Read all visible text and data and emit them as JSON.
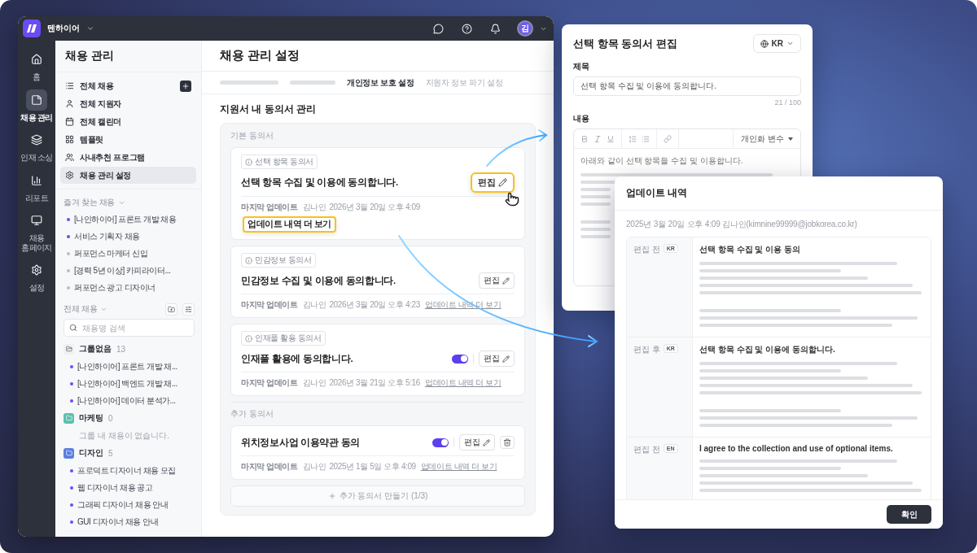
{
  "app": {
    "brand": "텐하이어",
    "avatar": "김",
    "rail": [
      {
        "label": "홈",
        "selected": false
      },
      {
        "label": "채용 관리",
        "selected": true
      },
      {
        "label": "인재 소싱",
        "selected": false
      },
      {
        "label": "리포트",
        "selected": false
      },
      {
        "label": "채용 홈페이지",
        "selected": false
      },
      {
        "label": "설정",
        "selected": false
      }
    ],
    "sidebar": {
      "title": "채용 관리",
      "nav": [
        {
          "label": "전체 채용",
          "kind": "with-add",
          "selected": false
        },
        {
          "label": "전체 지원자",
          "kind": "plain",
          "selected": false
        },
        {
          "label": "전체 캘린더",
          "kind": "plain",
          "selected": false
        },
        {
          "label": "템플릿",
          "kind": "plain",
          "selected": false
        },
        {
          "label": "사내추천 프로그램",
          "kind": "plain",
          "selected": false
        },
        {
          "label": "채용 관리 설정",
          "kind": "plain",
          "selected": true
        }
      ],
      "favorites": {
        "title": "즐겨 찾는 채용",
        "items": [
          {
            "label": "[나인하이어] 프론트 개발 채용",
            "color": "#6a4cf5"
          },
          {
            "label": "서비스 기획자 채용",
            "color": "#6a4cf5"
          },
          {
            "label": "퍼포먼스 마케터 신입",
            "color": "#b9bdc7"
          },
          {
            "label": "[경력 5년 이상] 카피라이터...",
            "color": "#b9bdc7"
          },
          {
            "label": "퍼포먼스 광고 디자이너",
            "color": "#b9bdc7"
          }
        ]
      },
      "all_jobs": {
        "title": "전체 채용",
        "search_placeholder": "채용명 검색",
        "groups": [
          {
            "name": "그룹없음",
            "count": "13",
            "items": [
              "[나인하이어] 프론트 개발 채...",
              "[나인하이어] 백엔드 개발 채...",
              "[나인하이어] 데이터 분석가..."
            ]
          },
          {
            "name": "마케팅",
            "count": "0",
            "color": "#5fbfae",
            "empty_text": "그룹 내 채용이 없습니다."
          },
          {
            "name": "디자인",
            "count": "5",
            "color": "#5b7fe0",
            "items": [
              "프로덕트 디자이너 채용 모집",
              "웹 디자이너 채용 공고",
              "그래픽 디자이너 채용 안내",
              "GUI 디자이너 채용 안내"
            ]
          }
        ]
      }
    }
  },
  "main": {
    "title": "채용 관리 설정",
    "tabs": [
      {
        "kind": "skeleton",
        "selected": false
      },
      {
        "kind": "skeleton",
        "selected": false
      },
      {
        "kind": "text",
        "label": "개인정보 보호 설정",
        "selected": true
      },
      {
        "kind": "text",
        "label": "지원자 정보 파기 설정",
        "selected": false
      }
    ],
    "section_title": "지원서 내 동의서 관리",
    "basic": {
      "title": "기본 동의서",
      "cards": [
        {
          "tag": "선택 항목 동의서",
          "title": "선택 항목 수집 및 이용에 동의합니다.",
          "edit_label": "편집",
          "update_label": "마지막 업데이트",
          "updated_by": "김나인",
          "updated_at": "2026년 3월 20일 오후 4:09",
          "history_link": "업데이트 내역 더 보기",
          "highlighted": true,
          "deletable": false
        },
        {
          "tag": "민감정보 동의서",
          "title": "민감정보 수집 및 이용에 동의합니다.",
          "edit_label": "편집",
          "update_label": "마지막 업데이트",
          "updated_by": "김나인",
          "updated_at": "2026년 3월 20일 오후 4:23",
          "history_link": "업데이트 내역 더 보기",
          "highlighted": false,
          "deletable": false
        },
        {
          "tag": "인재풀 활용 동의서",
          "title": "인재풀 활용에 동의합니다.",
          "toggle": {
            "on": true
          },
          "edit_label": "편집",
          "update_label": "마지막 업데이트",
          "updated_by": "김나인",
          "updated_at": "2026년 3월 21일 오후 5:16",
          "history_link": "업데이트 내역 더 보기",
          "highlighted": false,
          "deletable": false
        }
      ]
    },
    "extra": {
      "title": "추가 동의서",
      "cards": [
        {
          "title": "위치정보사업 이용약관 동의",
          "toggle": {
            "on": true
          },
          "edit_label": "편집",
          "update_label": "마지막 업데이트",
          "updated_by": "김나인",
          "updated_at": "2025년 1월 5일 오후 4:09",
          "history_link": "업데이트 내역 더 보기",
          "highlighted": false,
          "deletable": true
        }
      ],
      "create_button": "추가 동의서 만들기 (1/3)"
    }
  },
  "editor": {
    "title": "선택 항목 동의서 편집",
    "language": "KR",
    "subject_label": "제목",
    "subject_value": "선택 항목 수집 및 이용에 동의합니다.",
    "counter": "21 / 100",
    "content_label": "내용",
    "variables_menu": "개인화 변수",
    "body_text": "아래와 같이 선택 항목을 수집 및 이용합니다."
  },
  "history": {
    "title": "업데이트 내역",
    "meta": "2025년 3월 20일 오후 4:09 김나인(kimnine99999@jobkorea.co.kr)",
    "rows": [
      {
        "label": "편집 전",
        "lang": "KR",
        "heading": "선택 항목 수집 및 이용 동의"
      },
      {
        "label": "편집 후",
        "lang": "KR",
        "heading": "선택 항목 수집 및 이용에 동의합니다."
      },
      {
        "label": "편집 전",
        "lang": "EN",
        "heading": "I agree to the collection and use of optional items."
      }
    ],
    "confirm": "확인"
  }
}
